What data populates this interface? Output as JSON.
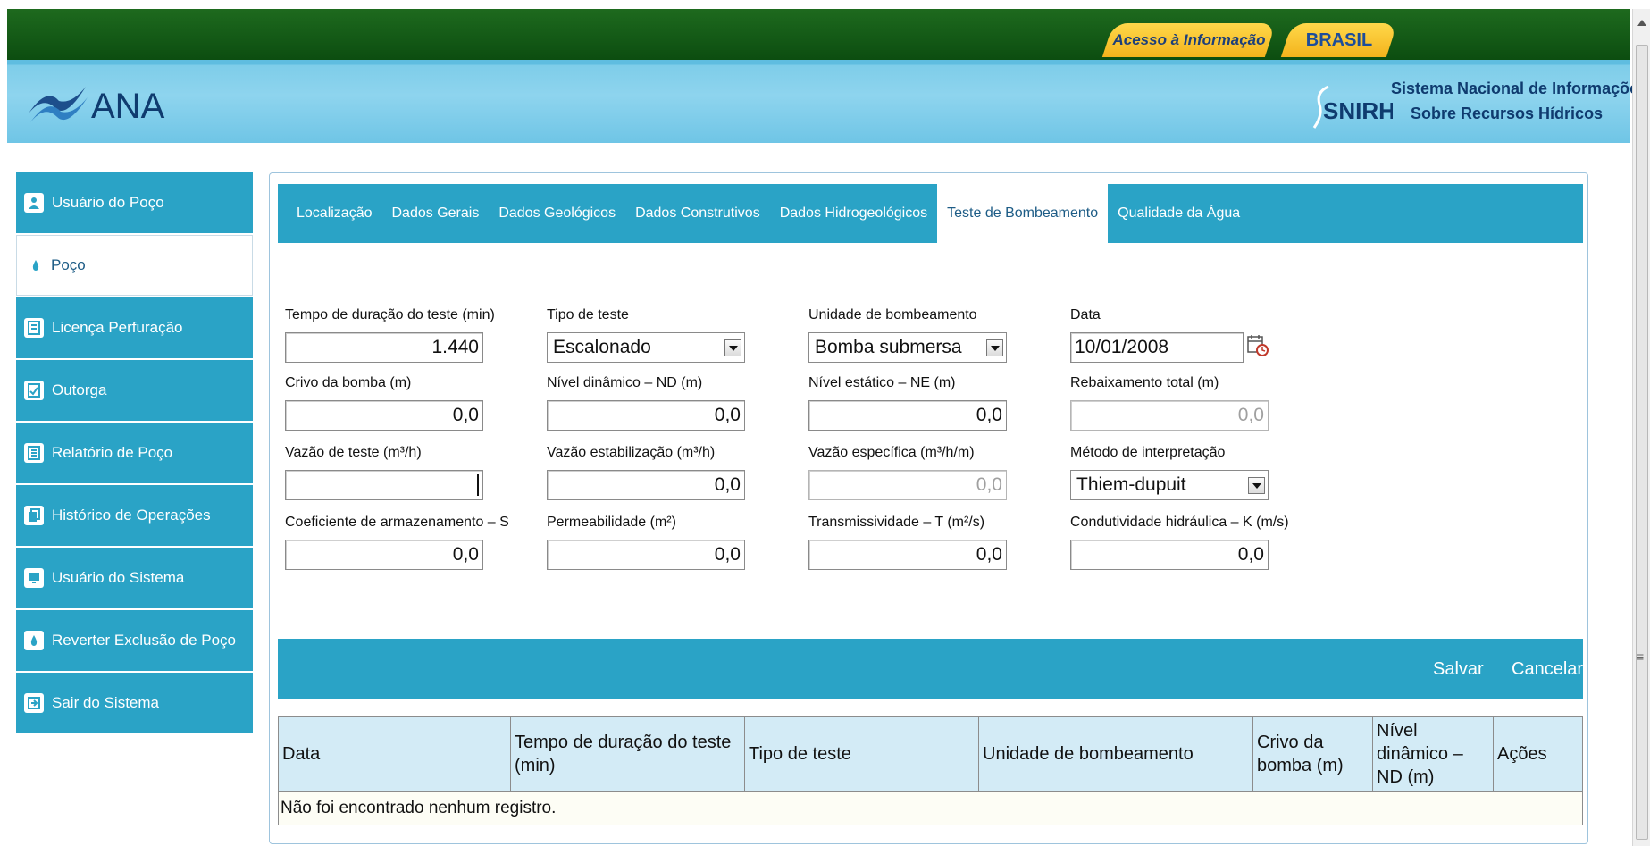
{
  "gov_bar": {
    "acesso_label": "Acesso à Informação",
    "brasil_label": "BRASIL"
  },
  "header": {
    "logo_text": "ANA",
    "snirh_logo_text": "SNIRH",
    "snirh_line1": "Sistema Nacional de Informações",
    "snirh_line2": "Sobre Recursos Hídricos"
  },
  "sidebar": {
    "items": [
      {
        "label": "Usuário do Poço",
        "icon": "user-icon",
        "active": false
      },
      {
        "label": "Poço",
        "icon": "water-drop-icon",
        "active": true
      },
      {
        "label": "Licença Perfuração",
        "icon": "document-icon",
        "active": false
      },
      {
        "label": "Outorga",
        "icon": "checklist-icon",
        "active": false
      },
      {
        "label": "Relatório de Poço",
        "icon": "report-icon",
        "active": false
      },
      {
        "label": "Histórico de Operações",
        "icon": "copy-icon",
        "active": false
      },
      {
        "label": "Usuário do Sistema",
        "icon": "monitor-icon",
        "active": false
      },
      {
        "label": "Reverter Exclusão de Poço",
        "icon": "water-drop-icon",
        "active": false
      },
      {
        "label": "Sair do Sistema",
        "icon": "exit-icon",
        "active": false
      }
    ]
  },
  "tabs": [
    {
      "label": "Localização",
      "active": false
    },
    {
      "label": "Dados Gerais",
      "active": false
    },
    {
      "label": "Dados Geológicos",
      "active": false
    },
    {
      "label": "Dados Construtivos",
      "active": false
    },
    {
      "label": "Dados Hidrogeológicos",
      "active": false
    },
    {
      "label": "Teste de Bombeamento",
      "active": true
    },
    {
      "label": "Qualidade da Água",
      "active": false
    }
  ],
  "form": {
    "tempo_duracao": {
      "label": "Tempo de duração do teste (min)",
      "value": "1.440"
    },
    "tipo_teste": {
      "label": "Tipo de teste",
      "value": "Escalonado"
    },
    "unidade_bombeamento": {
      "label": "Unidade de bombeamento",
      "value": "Bomba submersa"
    },
    "data": {
      "label": "Data",
      "value": "10/01/2008"
    },
    "crivo_bomba": {
      "label": "Crivo da bomba (m)",
      "value": "0,0"
    },
    "nivel_dinamico": {
      "label": "Nível dinâmico – ND (m)",
      "value": "0,0"
    },
    "nivel_estatico": {
      "label": "Nível estático – NE (m)",
      "value": "0,0"
    },
    "rebaixamento_total": {
      "label": "Rebaixamento total (m)",
      "value": "0,0"
    },
    "vazao_teste": {
      "label": "Vazão de teste (m³/h)",
      "value": ""
    },
    "vazao_estabilizacao": {
      "label": "Vazão estabilização (m³/h)",
      "value": "0,0"
    },
    "vazao_especifica": {
      "label": "Vazão específica (m³/h/m)",
      "value": "0,0"
    },
    "metodo_interpretacao": {
      "label": "Método de interpretação",
      "value": "Thiem-dupuit"
    },
    "coef_armazenamento": {
      "label": "Coeficiente de armazenamento – S",
      "value": "0,0"
    },
    "permeabilidade": {
      "label": "Permeabilidade (m²)",
      "value": "0,0"
    },
    "transmissividade": {
      "label": "Transmissividade – T (m²/s)",
      "value": "0,0"
    },
    "condutividade": {
      "label": "Condutividade hidráulica – K (m/s)",
      "value": "0,0"
    }
  },
  "actions": {
    "save_label": "Salvar",
    "cancel_label": "Cancelar"
  },
  "table": {
    "headers": [
      "Data",
      "Tempo de duração do teste (min)",
      "Tipo de teste",
      "Unidade de bombeamento",
      "Crivo da bomba (m)",
      "Nível dinâmico – ND (m)",
      "Ações"
    ],
    "empty_message": "Não foi encontrado nenhum registro."
  },
  "colors": {
    "gov_green": "#1e6a1e",
    "header_blue": "#8ed4ee",
    "accent_teal": "#2aa3c6",
    "gold": "#f3b31c"
  }
}
